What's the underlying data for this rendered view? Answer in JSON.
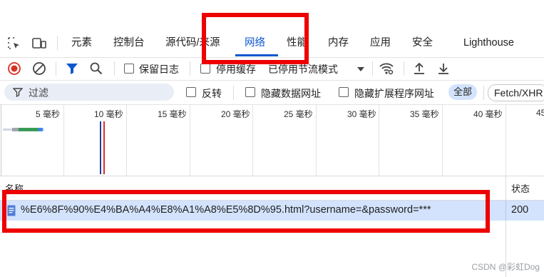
{
  "tabs": [
    {
      "label": "元素"
    },
    {
      "label": "控制台"
    },
    {
      "label": "源代码/来源"
    },
    {
      "label": "网络"
    },
    {
      "label": "性能"
    },
    {
      "label": "内存"
    },
    {
      "label": "应用"
    },
    {
      "label": "安全"
    },
    {
      "label": "Lighthouse"
    }
  ],
  "toolbar": {
    "preserve_log": "保留日志",
    "disable_cache": "停用缓存",
    "throttling": "已停用节流模式"
  },
  "filterbar": {
    "filter_placeholder": "过滤",
    "invert": "反转",
    "hide_data_urls": "隐藏数据网址",
    "hide_extension_urls": "隐藏扩展程序网址",
    "all": "全部",
    "fetch_xhr": "Fetch/XHR"
  },
  "timeline": {
    "ticks": [
      "5 毫秒",
      "10 毫秒",
      "15 毫秒",
      "20 毫秒",
      "25 毫秒",
      "30 毫秒",
      "35 毫秒",
      "40 毫秒",
      "45"
    ]
  },
  "table": {
    "col_name": "名称",
    "col_status": "状态",
    "rows": [
      {
        "name": "%E6%8F%90%E4%BA%A4%E8%A1%A8%E5%8D%95.html?username=&password=***",
        "status": "200"
      }
    ]
  },
  "watermark": "CSDN @彩虹Dog",
  "colors": {
    "accent": "#0b57d0",
    "highlight_box": "#ee0000",
    "selected_row": "#d3e3fd",
    "record_red": "#d93025"
  }
}
